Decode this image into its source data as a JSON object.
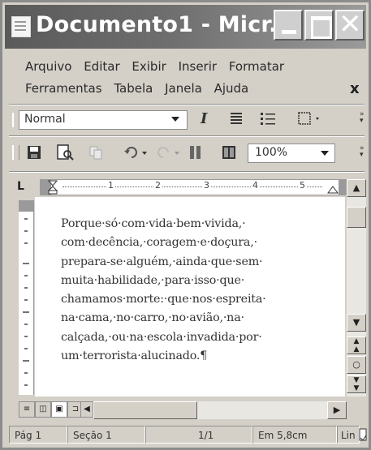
{
  "window": {
    "title": "Documento1 - Micr..."
  },
  "menu": {
    "row1": [
      "Arquivo",
      "Editar",
      "Exibir",
      "Inserir",
      "Formatar"
    ],
    "row2": [
      "Ferramentas",
      "Tabela",
      "Janela",
      "Ajuda"
    ],
    "close_glyph": "x"
  },
  "format_toolbar": {
    "style_value": "Normal",
    "italic_label": "I"
  },
  "standard_toolbar": {
    "zoom_value": "100%"
  },
  "ruler": {
    "marks": [
      "1",
      "2",
      "3",
      "4",
      "5"
    ]
  },
  "document": {
    "lines": [
      "Porque·só·com·vida·bem·vivida,·",
      "com·decência,·coragem·e·doçura,·",
      "prepara-se·alguém,·ainda·que·sem·",
      "muita·habilidade,·para·isso·que·",
      "chamamos·morte:·que·nos·espreita·",
      "na·cama,·no·carro,·no·avião,·na·",
      "calçada,·ou·na·escola·invadida·por·",
      "um·terrorista·alucinado.¶"
    ]
  },
  "status_bar": {
    "page": "Pág 1",
    "section": "Seção 1",
    "pages": "1/1",
    "position": "Em 5,8cm",
    "line": "Lin"
  },
  "icons": {
    "title": "word-document-icon",
    "minimize": "minimize-icon",
    "maximize": "maximize-icon",
    "close": "close-icon"
  }
}
